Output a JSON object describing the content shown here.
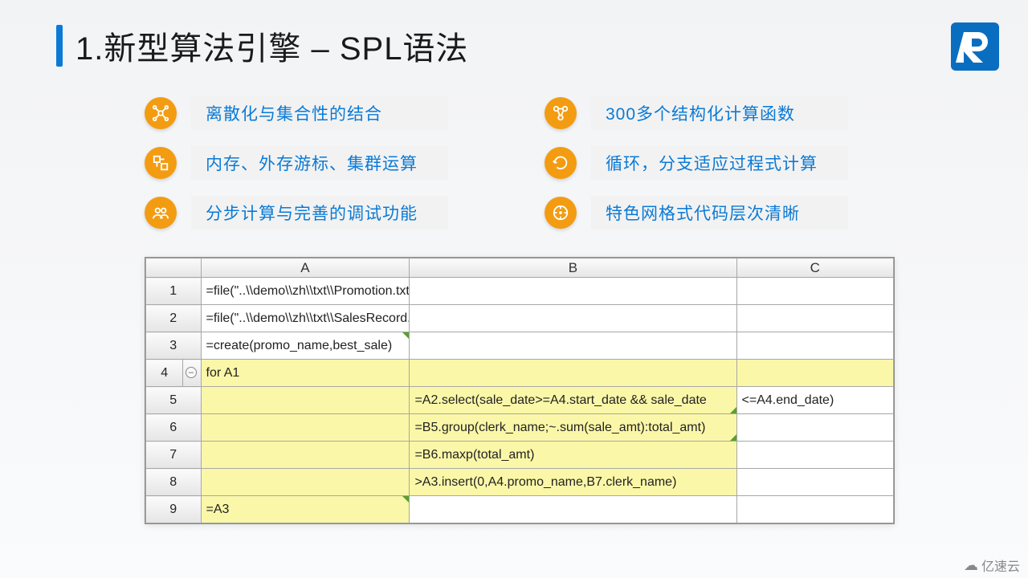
{
  "title": "1.新型算法引擎 – SPL语法",
  "logo_letter": "R",
  "features": {
    "left": [
      {
        "icon": "network-icon",
        "label": "离散化与集合性的结合"
      },
      {
        "icon": "cursor-icon",
        "label": "内存、外存游标、集群运算"
      },
      {
        "icon": "people-icon",
        "label": "分步计算与完善的调试功能"
      }
    ],
    "right": [
      {
        "icon": "nodes-icon",
        "label": "300多个结构化计算函数"
      },
      {
        "icon": "loop-icon",
        "label": "循环，分支适应过程式计算"
      },
      {
        "icon": "target-icon",
        "label": "特色网格式代码层次清晰"
      }
    ]
  },
  "grid": {
    "columns": [
      "A",
      "B",
      "C"
    ],
    "rows": [
      {
        "n": "1",
        "A": "=file(\"..\\\\demo\\\\zh\\\\txt\\\\Promotion.txt\").import@t()",
        "B": "",
        "C": "",
        "hl": {
          "A": false,
          "B": false,
          "C": false
        }
      },
      {
        "n": "2",
        "A": "=file(\"..\\\\demo\\\\zh\\\\txt\\\\SalesRecord.txt\").import@t()",
        "B": "",
        "C": "",
        "hl": {
          "A": false,
          "B": false,
          "C": false
        }
      },
      {
        "n": "3",
        "A": "=create(promo_name,best_sale)",
        "B": "",
        "C": "",
        "hl": {
          "A": false,
          "B": false,
          "C": false
        }
      },
      {
        "n": "4",
        "A": "for A1",
        "B": "",
        "C": "",
        "hl": {
          "A": true,
          "B": true,
          "C": true
        }
      },
      {
        "n": "5",
        "A": "",
        "B": "=A2.select(sale_date>=A4.start_date && sale_date",
        "C": "<=A4.end_date)",
        "hl": {
          "A": true,
          "B": true,
          "C": false
        }
      },
      {
        "n": "6",
        "A": "",
        "B": "=B5.group(clerk_name;~.sum(sale_amt):total_amt)",
        "C": "",
        "hl": {
          "A": true,
          "B": true,
          "C": false
        }
      },
      {
        "n": "7",
        "A": "",
        "B": "=B6.maxp(total_amt)",
        "C": "",
        "hl": {
          "A": true,
          "B": true,
          "C": false
        }
      },
      {
        "n": "8",
        "A": "",
        "B": ">A3.insert(0,A4.promo_name,B7.clerk_name)",
        "C": "",
        "hl": {
          "A": true,
          "B": true,
          "C": false
        }
      },
      {
        "n": "9",
        "A": "=A3",
        "B": "",
        "C": "",
        "hl": {
          "A": true,
          "B": false,
          "C": false
        }
      }
    ]
  },
  "watermark": "亿速云"
}
